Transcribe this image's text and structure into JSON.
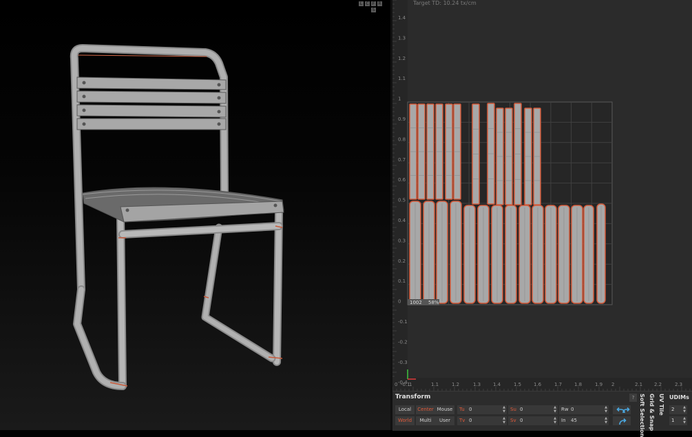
{
  "viewport_buttons": [
    "L",
    "C",
    "F",
    "R",
    "S"
  ],
  "uv_editor": {
    "target_td": "Target TD: 10.24 tx/cm",
    "y_ticks": [
      "1.4",
      "1.3",
      "1.2",
      "1.1",
      "1",
      "0.9",
      "0.8",
      "0.7",
      "0.6",
      "0.5",
      "0.4",
      "0.3",
      "0.2",
      "0.1",
      "0",
      "-0.1",
      "-0.2",
      "-0.3",
      "-0.4"
    ],
    "x_ticks": [
      "0",
      "-0.1",
      "1",
      "1.1",
      "1.2",
      "1.3",
      "1.4",
      "1.5",
      "1.6",
      "1.7",
      "1.8",
      "1.9",
      "2",
      "2.1",
      "2.2",
      "2.3"
    ],
    "tile_id": "1002",
    "tile_percent": "58%"
  },
  "transform": {
    "title": "Transform",
    "help": "?",
    "mode_row1": [
      "Local",
      "Center",
      "Mouse"
    ],
    "mode_row2": [
      "World",
      "Multi",
      "User"
    ],
    "fields": [
      {
        "label": "Tu",
        "value": "0"
      },
      {
        "label": "Tv",
        "value": "0"
      },
      {
        "label": "Su",
        "value": "0"
      },
      {
        "label": "Sv",
        "value": "0"
      },
      {
        "label": "Rw",
        "value": "0"
      },
      {
        "label": "In",
        "value": "45"
      }
    ],
    "accent_color": "#e05a3a"
  },
  "side_tabs": {
    "soft_selection": "Soft Selection",
    "grid_snap": "Grid & Snap",
    "uv_tile": "UV Tile"
  },
  "udims": {
    "title": "UDIMs",
    "values": [
      "2",
      "1"
    ]
  },
  "icons": [
    "undo-arrow-icon",
    "redo-arrow-icon",
    "rotate-arrow-icon",
    "axis-gizmo-icon"
  ]
}
